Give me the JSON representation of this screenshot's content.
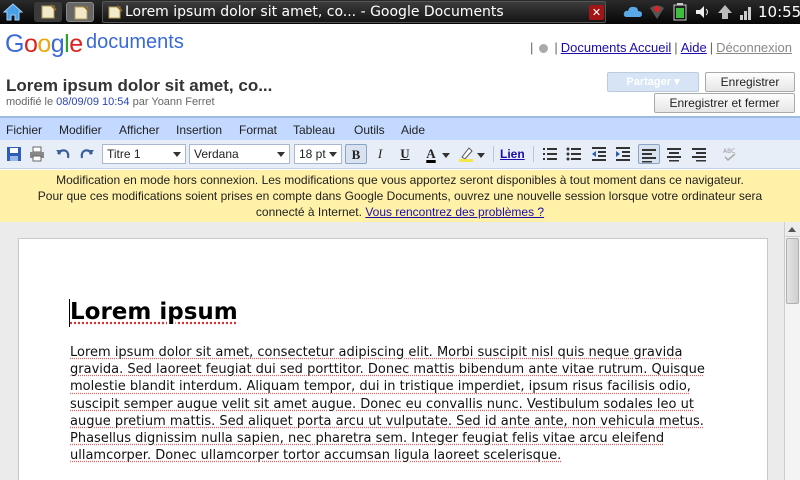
{
  "system": {
    "tab_title": "Lorem ipsum dolor sit amet, co... - Google Documents",
    "close_glyph": "✕",
    "clock": "10:55"
  },
  "header": {
    "logo": {
      "g": "G",
      "o1": "o",
      "o2": "o",
      "g2": "g",
      "l": "l",
      "e": "e"
    },
    "logo_suffix": "documents",
    "links": {
      "home": "Documents Accueil",
      "help": "Aide",
      "logout": "Déconnexion"
    },
    "doc_title": "Lorem ipsum dolor sit amet, co...",
    "modified_prefix": "modifié le",
    "modified_date": "08/09/09 10:54",
    "modified_by": "par Yoann Ferret",
    "share_label": "Partager ▾",
    "save_label": "Enregistrer",
    "save_close_label": "Enregistrer et fermer"
  },
  "menu": [
    "Fichier",
    "Modifier",
    "Afficher",
    "Insertion",
    "Format",
    "Tableau",
    "Outils",
    "Aide"
  ],
  "toolbar": {
    "style_select": "Titre 1",
    "font_select": "Verdana",
    "size_select": "18 pt",
    "bold": "B",
    "italic": "I",
    "underline": "U",
    "text_color": "A",
    "link": "Lien"
  },
  "notice": {
    "line1": "Modification en mode hors connexion. Les modifications que vous apportez seront disponibles à tout moment dans ce navigateur.",
    "line2": "Pour que ces modifications soient prises en compte dans Google Documents, ouvrez une nouvelle session lorsque votre ordinateur sera",
    "line3": "connecté à Internet.",
    "link": "Vous rencontrez des problèmes ?"
  },
  "document": {
    "heading": "Lorem ipsum",
    "body": "Lorem ipsum dolor sit amet, consectetur adipiscing elit. Morbi suscipit nisl quis neque gravida gravida. Sed laoreet feugiat dui sed porttitor. Donec mattis bibendum ante vitae rutrum. Quisque molestie blandit interdum. Aliquam tempor, dui in tristique imperdiet, ipsum risus facilisis odio, suscipit semper augue velit sit amet augue. Donec eu convallis nunc. Vestibulum sodales leo ut augue pretium mattis. Sed aliquet porta arcu ut vulputate. Sed id ante ante, non vehicula metus. Phasellus dignissim nulla sapien, nec pharetra sem. Integer feugiat felis vitae arcu eleifend ullamcorper. Donec ullamcorper tortor accumsan ligula laoreet scelerisque."
  },
  "colors": {
    "menubar": "#c3d9ff",
    "notice_bg": "#fff1a8",
    "link": "#1a0dab"
  }
}
